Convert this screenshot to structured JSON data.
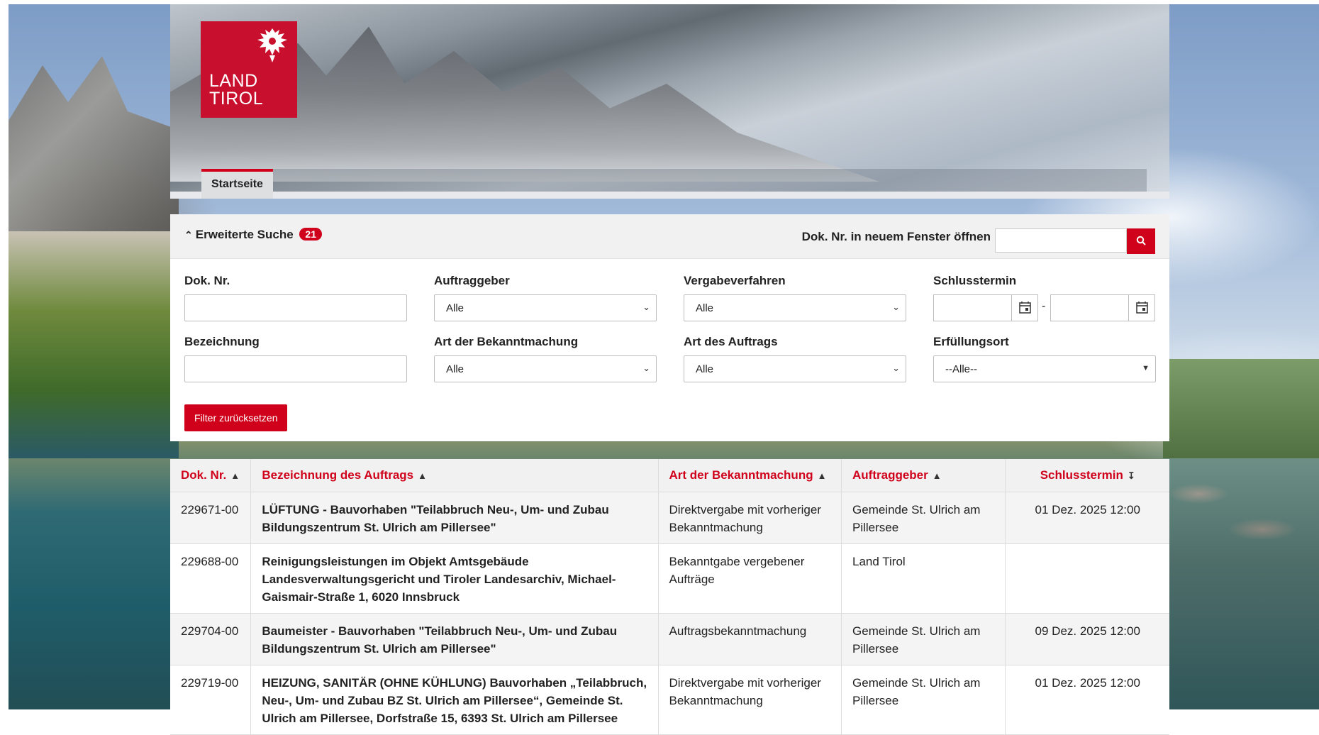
{
  "brand": {
    "line1": "LAND",
    "line2": "TIROL",
    "color": "#c8102e"
  },
  "nav": {
    "tab_home": "Startseite"
  },
  "search": {
    "toggle_label": "Erweiterte Suche",
    "badge_count": "21",
    "open_doc_label": "Dok. Nr. in neuem Fenster öffnen",
    "open_doc_value": "",
    "fields": {
      "dok_nr": "Dok. Nr.",
      "auftraggeber": "Auftraggeber",
      "vergabeverfahren": "Vergabeverfahren",
      "schlusstermin": "Schlusstermin",
      "bezeichnung": "Bezeichnung",
      "art_bekanntmachung": "Art der Bekanntmachung",
      "art_auftrag": "Art des Auftrags",
      "erfuellungsort": "Erfüllungsort"
    },
    "values": {
      "auftraggeber": "Alle",
      "vergabeverfahren": "Alle",
      "art_bekanntmachung": "Alle",
      "art_auftrag": "Alle",
      "erfuellungsort": "--Alle--"
    },
    "date_separator": "-",
    "reset_label": "Filter zurücksetzen"
  },
  "table": {
    "headers": [
      "Dok. Nr.",
      "Bezeichnung des Auftrags",
      "Art der Bekanntmachung",
      "Auftraggeber",
      "Schlusstermin"
    ],
    "rows": [
      {
        "dok": "229671-00",
        "title": "LÜFTUNG - Bauvorhaben \"Teilabbruch Neu-, Um- und Zubau Bildungszentrum St. Ulrich am Pillersee\"",
        "art": "Direktvergabe mit vorheriger Bekanntmachung",
        "ag": "Gemeinde St. Ulrich am Pillersee",
        "date": "01 Dez. 2025 12:00"
      },
      {
        "dok": "229688-00",
        "title": "Reinigungsleistungen im Objekt Amtsgebäude Landesverwaltungsgericht und Tiroler Landesarchiv, Michael-Gaismair-Straße 1, 6020 Innsbruck",
        "art": "Bekanntgabe vergebener Aufträge",
        "ag": "Land Tirol",
        "date": ""
      },
      {
        "dok": "229704-00",
        "title": "Baumeister - Bauvorhaben \"Teilabbruch Neu-, Um- und Zubau Bildungszentrum St. Ulrich am Pillersee\"",
        "art": "Auftragsbekanntmachung",
        "ag": "Gemeinde St. Ulrich am Pillersee",
        "date": "09 Dez. 2025 12:00"
      },
      {
        "dok": "229719-00",
        "title": "HEIZUNG, SANITÄR (OHNE KÜHLUNG) Bauvorhaben „Teilabbruch, Neu-, Um- und Zubau BZ St. Ulrich am Pillersee“, Gemeinde St. Ulrich am Pillersee, Dorfstraße 15, 6393 St. Ulrich am Pillersee",
        "art": "Direktvergabe mit vorheriger Bekanntmachung",
        "ag": "Gemeinde St. Ulrich am Pillersee",
        "date": "01 Dez. 2025 12:00"
      }
    ]
  }
}
